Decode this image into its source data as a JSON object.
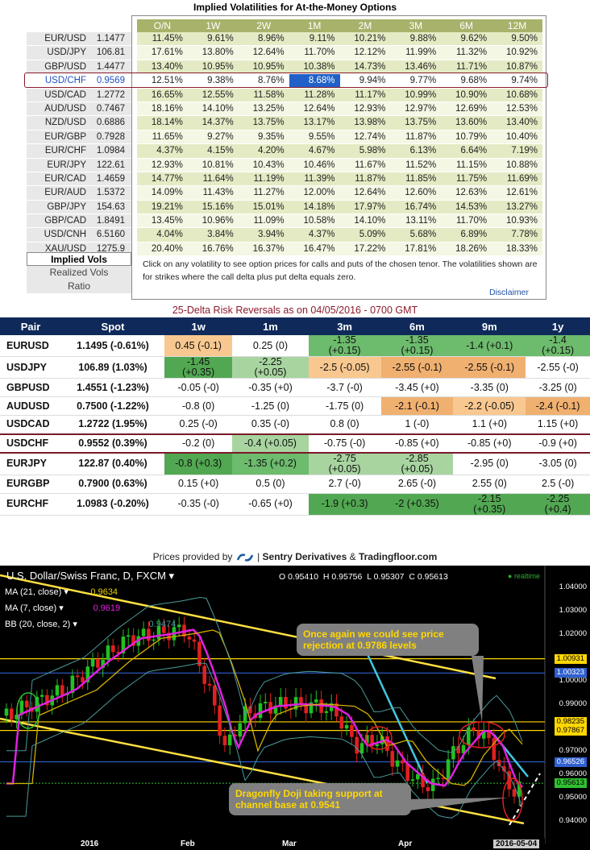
{
  "iv": {
    "title": "Implied Volatilities for At-the-Money Options",
    "tenors": [
      "O/N",
      "1W",
      "2W",
      "1M",
      "2M",
      "3M",
      "6M",
      "12M"
    ],
    "rows": [
      {
        "pair": "EUR/USD",
        "spot": "1.1477",
        "vals": [
          "11.45%",
          "9.61%",
          "8.96%",
          "9.11%",
          "10.21%",
          "9.88%",
          "9.62%",
          "9.50%"
        ]
      },
      {
        "pair": "USD/JPY",
        "spot": "106.81",
        "vals": [
          "17.61%",
          "13.80%",
          "12.64%",
          "11.70%",
          "12.12%",
          "11.99%",
          "11.32%",
          "10.92%"
        ]
      },
      {
        "pair": "GBP/USD",
        "spot": "1.4477",
        "vals": [
          "13.40%",
          "10.95%",
          "10.95%",
          "10.38%",
          "14.73%",
          "13.46%",
          "11.71%",
          "10.87%"
        ]
      },
      {
        "pair": "USD/CHF",
        "spot": "0.9569",
        "vals": [
          "12.51%",
          "9.38%",
          "8.76%",
          "8.68%",
          "9.94%",
          "9.77%",
          "9.68%",
          "9.74%"
        ]
      },
      {
        "pair": "USD/CAD",
        "spot": "1.2772",
        "vals": [
          "16.65%",
          "12.55%",
          "11.58%",
          "11.28%",
          "11.17%",
          "10.99%",
          "10.90%",
          "10.68%"
        ]
      },
      {
        "pair": "AUD/USD",
        "spot": "0.7467",
        "vals": [
          "18.16%",
          "14.10%",
          "13.25%",
          "12.64%",
          "12.93%",
          "12.97%",
          "12.69%",
          "12.53%"
        ]
      },
      {
        "pair": "NZD/USD",
        "spot": "0.6886",
        "vals": [
          "18.14%",
          "14.37%",
          "13.75%",
          "13.17%",
          "13.98%",
          "13.75%",
          "13.60%",
          "13.40%"
        ]
      },
      {
        "pair": "EUR/GBP",
        "spot": "0.7928",
        "vals": [
          "11.65%",
          "9.27%",
          "9.35%",
          "9.55%",
          "12.74%",
          "11.87%",
          "10.79%",
          "10.40%"
        ]
      },
      {
        "pair": "EUR/CHF",
        "spot": "1.0984",
        "vals": [
          "4.37%",
          "4.15%",
          "4.20%",
          "4.67%",
          "5.98%",
          "6.13%",
          "6.64%",
          "7.19%"
        ]
      },
      {
        "pair": "EUR/JPY",
        "spot": "122.61",
        "vals": [
          "12.93%",
          "10.81%",
          "10.43%",
          "10.46%",
          "11.67%",
          "11.52%",
          "11.15%",
          "10.88%"
        ]
      },
      {
        "pair": "EUR/CAD",
        "spot": "1.4659",
        "vals": [
          "14.77%",
          "11.64%",
          "11.19%",
          "11.39%",
          "11.87%",
          "11.85%",
          "11.75%",
          "11.69%"
        ]
      },
      {
        "pair": "EUR/AUD",
        "spot": "1.5372",
        "vals": [
          "14.09%",
          "11.43%",
          "11.27%",
          "12.00%",
          "12.64%",
          "12.60%",
          "12.63%",
          "12.61%"
        ]
      },
      {
        "pair": "GBP/JPY",
        "spot": "154.63",
        "vals": [
          "19.21%",
          "15.16%",
          "15.01%",
          "14.18%",
          "17.97%",
          "16.74%",
          "14.53%",
          "13.27%"
        ]
      },
      {
        "pair": "GBP/CAD",
        "spot": "1.8491",
        "vals": [
          "13.45%",
          "10.96%",
          "11.09%",
          "10.58%",
          "14.10%",
          "13.11%",
          "11.70%",
          "10.93%"
        ]
      },
      {
        "pair": "USD/CNH",
        "spot": "6.5160",
        "vals": [
          "4.04%",
          "3.84%",
          "3.94%",
          "4.37%",
          "5.09%",
          "5.68%",
          "6.89%",
          "7.78%"
        ]
      },
      {
        "pair": "XAU/USD",
        "spot": "1275.9",
        "vals": [
          "20.40%",
          "16.76%",
          "16.37%",
          "16.47%",
          "17.22%",
          "17.81%",
          "18.26%",
          "18.33%"
        ]
      }
    ],
    "tabs": [
      "Implied Vols",
      "Realized Vols",
      "Ratio"
    ],
    "note": "Click on any volatility to see option prices for calls and puts of the chosen tenor. The volatilities shown are for strikes where the call delta plus put delta equals zero.",
    "disclaimer": "Disclaimer"
  },
  "rr": {
    "title": "25-Delta Risk Reversals as on 04/05/2016 - 0700 GMT",
    "headers": [
      "Pair",
      "Spot",
      "1w",
      "1m",
      "3m",
      "6m",
      "9m",
      "1y"
    ],
    "rows": [
      {
        "pair": "EURUSD",
        "spot": "1.1495 (-0.61%)",
        "vals": [
          "0.45 (-0.1)",
          "0.25 (0)",
          "-1.35\n(+0.15)",
          "-1.35\n(+0.15)",
          "-1.4 (+0.1)",
          "-1.4\n(+0.15)"
        ],
        "colors": [
          "#f8c890",
          "#ffffff",
          "#6dbb6d",
          "#6dbb6d",
          "#6dbb6d",
          "#6dbb6d"
        ]
      },
      {
        "pair": "USDJPY",
        "spot": "106.89 (1.03%)",
        "vals": [
          "-1.45\n(+0.35)",
          "-2.25\n(+0.05)",
          "-2.5 (-0.05)",
          "-2.55 (-0.1)",
          "-2.55 (-0.1)",
          "-2.55 (-0)"
        ],
        "colors": [
          "#52a852",
          "#a8d4a0",
          "#f8c890",
          "#f0b070",
          "#f0b070",
          "#ffffff"
        ]
      },
      {
        "pair": "GBPUSD",
        "spot": "1.4551 (-1.23%)",
        "vals": [
          "-0.05 (-0)",
          "-0.35 (+0)",
          "-3.7 (-0)",
          "-3.45 (+0)",
          "-3.35 (0)",
          "-3.25 (0)"
        ],
        "colors": [
          "#ffffff",
          "#ffffff",
          "#ffffff",
          "#ffffff",
          "#ffffff",
          "#ffffff"
        ]
      },
      {
        "pair": "AUDUSD",
        "spot": "0.7500 (-1.22%)",
        "vals": [
          "-0.8 (0)",
          "-1.25 (0)",
          "-1.75 (0)",
          "-2.1 (-0.1)",
          "-2.2 (-0.05)",
          "-2.4 (-0.1)"
        ],
        "colors": [
          "#ffffff",
          "#ffffff",
          "#ffffff",
          "#f0b070",
          "#f8c890",
          "#f0b070"
        ]
      },
      {
        "pair": "USDCAD",
        "spot": "1.2722 (1.95%)",
        "vals": [
          "0.25 (-0)",
          "0.35 (-0)",
          "0.8 (0)",
          "1 (-0)",
          "1.1 (+0)",
          "1.15 (+0)"
        ],
        "colors": [
          "#ffffff",
          "#ffffff",
          "#ffffff",
          "#ffffff",
          "#ffffff",
          "#ffffff"
        ]
      },
      {
        "pair": "USDCHF",
        "spot": "0.9552 (0.39%)",
        "vals": [
          "-0.2 (0)",
          "-0.4 (+0.05)",
          "-0.75 (-0)",
          "-0.85 (+0)",
          "-0.85 (+0)",
          "-0.9 (+0)"
        ],
        "colors": [
          "#ffffff",
          "#a8d4a0",
          "#ffffff",
          "#ffffff",
          "#ffffff",
          "#ffffff"
        ]
      },
      {
        "pair": "EURJPY",
        "spot": "122.87 (0.40%)",
        "vals": [
          "-0.8 (+0.3)",
          "-1.35 (+0.2)",
          "-2.75\n(+0.05)",
          "-2.85\n(+0.05)",
          "-2.95 (0)",
          "-3.05 (0)"
        ],
        "colors": [
          "#52a852",
          "#6dbb6d",
          "#a8d4a0",
          "#a8d4a0",
          "#ffffff",
          "#ffffff"
        ]
      },
      {
        "pair": "EURGBP",
        "spot": "0.7900 (0.63%)",
        "vals": [
          "0.15 (+0)",
          "0.5 (0)",
          "2.7 (-0)",
          "2.65 (-0)",
          "2.55 (0)",
          "2.5 (-0)"
        ],
        "colors": [
          "#ffffff",
          "#ffffff",
          "#ffffff",
          "#ffffff",
          "#ffffff",
          "#ffffff"
        ]
      },
      {
        "pair": "EURCHF",
        "spot": "1.0983 (-0.20%)",
        "vals": [
          "-0.35 (-0)",
          "-0.65 (+0)",
          "-1.9 (+0.3)",
          "-2 (+0.35)",
          "-2.15\n(+0.35)",
          "-2.25\n(+0.4)"
        ],
        "colors": [
          "#ffffff",
          "#ffffff",
          "#52a852",
          "#52a852",
          "#52a852",
          "#52a852"
        ]
      }
    ]
  },
  "credit": {
    "prefix": "Prices provided by",
    "brand1": "Sentry Derivatives",
    "amp": "&",
    "brand2": "Tradingfloor.com"
  },
  "chart": {
    "header": "U.S. Dollar/Swiss Franc, D, FXCM",
    "ohlc": {
      "o": "O 0.95410",
      "h": "H 0.95756",
      "l": "L 0.95307",
      "c": "C 0.95613"
    },
    "realtime": "realtime",
    "ma21": {
      "label": "MA (21, close)",
      "value": "0.9634",
      "color": "#e8d000"
    },
    "ma7": {
      "label": "MA (7, close)",
      "value": "0.9619",
      "color": "#e020e0"
    },
    "bb": {
      "label": "BB (20, close, 2)",
      "value": "0.9474",
      "color": "#4a9a9a"
    },
    "yaxis": [
      "1.04000",
      "1.03000",
      "1.02000",
      "1.00000",
      "0.99000",
      "0.97000",
      "0.96000",
      "0.95000",
      "0.94000"
    ],
    "price_labels": [
      {
        "v": "1.00931",
        "bg": "#ffd700"
      },
      {
        "v": "1.00323",
        "bg": "#3060d0"
      },
      {
        "v": "0.98235",
        "bg": "#ffd700"
      },
      {
        "v": "0.97867",
        "bg": "#ffd700"
      },
      {
        "v": "0.96526",
        "bg": "#3060d0"
      },
      {
        "v": "0.95613",
        "bg": "#30c030"
      }
    ],
    "xaxis": [
      "2016",
      "Feb",
      "Mar",
      "Apr",
      "2016-05-04"
    ],
    "callout1": "Once again we could see price rejection at 0.9786 levels",
    "callout2": "Dragonfly Doji taking support at channel base at 0.9541"
  }
}
